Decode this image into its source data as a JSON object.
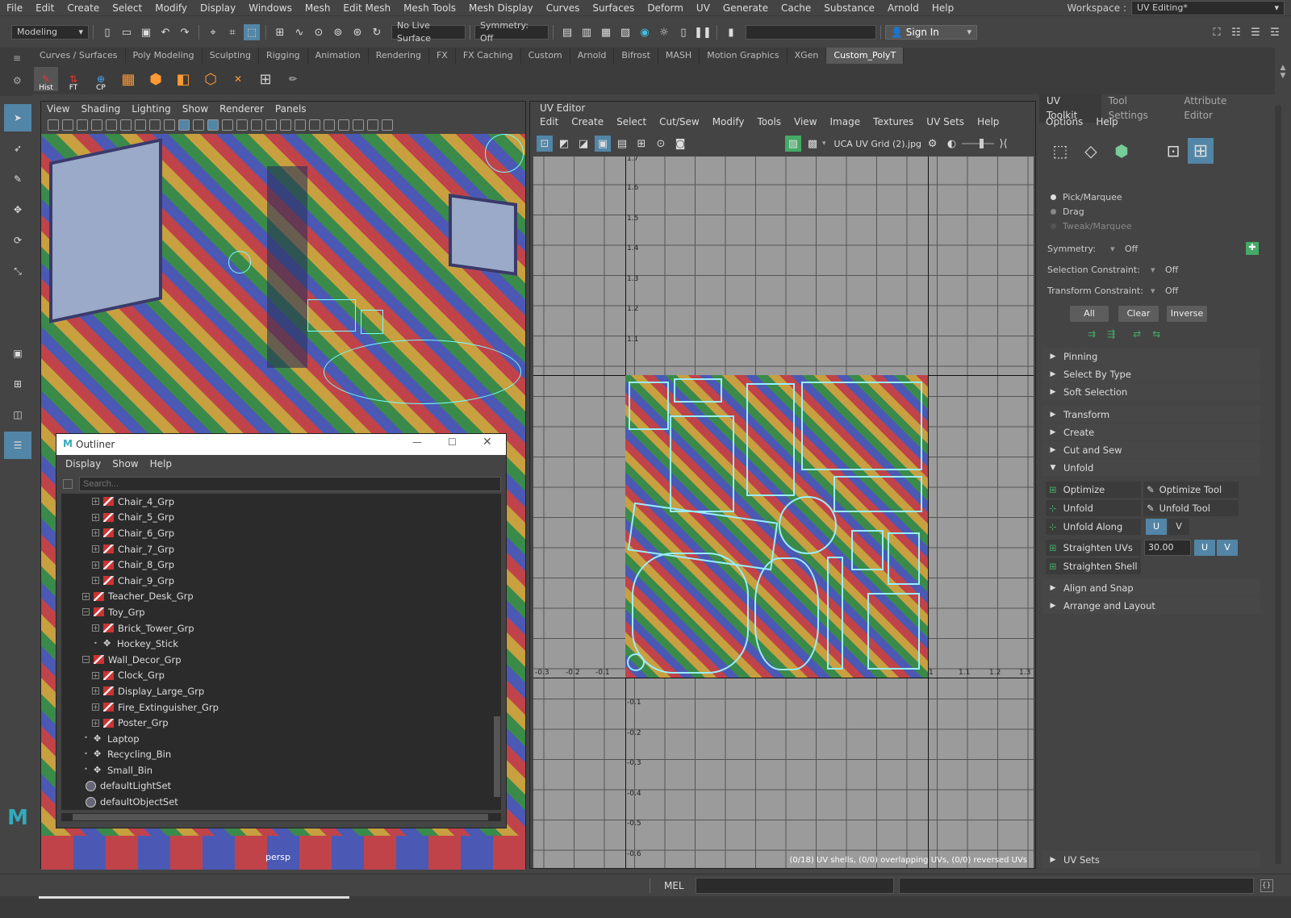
{
  "menubar": {
    "items": [
      "File",
      "Edit",
      "Create",
      "Select",
      "Modify",
      "Display",
      "Windows",
      "Mesh",
      "Edit Mesh",
      "Mesh Tools",
      "Mesh Display",
      "Curves",
      "Surfaces",
      "Deform",
      "UV",
      "Generate",
      "Cache",
      "Substance",
      "Arnold",
      "Help"
    ],
    "workspace_label": "Workspace :",
    "workspace_value": "UV Editing*"
  },
  "status": {
    "mode": "Modeling",
    "live_surface": "No Live Surface",
    "symmetry": "Symmetry: Off",
    "sign_in": "Sign In"
  },
  "shelf": {
    "tabs": [
      "Curves / Surfaces",
      "Poly Modeling",
      "Sculpting",
      "Rigging",
      "Animation",
      "Rendering",
      "FX",
      "FX Caching",
      "Custom",
      "Arnold",
      "Bifrost",
      "MASH",
      "Motion Graphics",
      "XGen",
      "Custom_PolyT"
    ],
    "active_tab": "Custom_PolyT",
    "captions": [
      "Hist",
      "FT",
      "CP"
    ]
  },
  "viewport": {
    "menu": [
      "View",
      "Shading",
      "Lighting",
      "Show",
      "Renderer",
      "Panels"
    ],
    "camera": "persp"
  },
  "outliner": {
    "title": "Outliner",
    "menu": [
      "Display",
      "Show",
      "Help"
    ],
    "search_placeholder": "Search...",
    "rows": [
      {
        "label": "Chair_4_Grp",
        "indent": 2,
        "kind": "group",
        "exp": "+"
      },
      {
        "label": "Chair_5_Grp",
        "indent": 2,
        "kind": "group",
        "exp": "+"
      },
      {
        "label": "Chair_6_Grp",
        "indent": 2,
        "kind": "group",
        "exp": "+"
      },
      {
        "label": "Chair_7_Grp",
        "indent": 2,
        "kind": "group",
        "exp": "+"
      },
      {
        "label": "Chair_8_Grp",
        "indent": 2,
        "kind": "group",
        "exp": "+"
      },
      {
        "label": "Chair_9_Grp",
        "indent": 2,
        "kind": "group",
        "exp": "+"
      },
      {
        "label": "Teacher_Desk_Grp",
        "indent": 1,
        "kind": "group",
        "exp": "+"
      },
      {
        "label": "Toy_Grp",
        "indent": 1,
        "kind": "group",
        "exp": "-"
      },
      {
        "label": "Brick_Tower_Grp",
        "indent": 2,
        "kind": "group",
        "exp": "+"
      },
      {
        "label": "Hockey_Stick",
        "indent": 2,
        "kind": "mesh",
        "exp": ""
      },
      {
        "label": "Wall_Decor_Grp",
        "indent": 1,
        "kind": "group",
        "exp": "-"
      },
      {
        "label": "Clock_Grp",
        "indent": 2,
        "kind": "group",
        "exp": "+"
      },
      {
        "label": "Display_Large_Grp",
        "indent": 2,
        "kind": "group",
        "exp": "+"
      },
      {
        "label": "Fire_Extinguisher_Grp",
        "indent": 2,
        "kind": "group",
        "exp": "+"
      },
      {
        "label": "Poster_Grp",
        "indent": 2,
        "kind": "group",
        "exp": "+"
      },
      {
        "label": "Laptop",
        "indent": 1,
        "kind": "mesh",
        "exp": ""
      },
      {
        "label": "Recycling_Bin",
        "indent": 1,
        "kind": "mesh",
        "exp": ""
      },
      {
        "label": "Small_Bin",
        "indent": 1,
        "kind": "mesh",
        "exp": ""
      },
      {
        "label": "defaultLightSet",
        "indent": 0,
        "kind": "set",
        "exp": ""
      },
      {
        "label": "defaultObjectSet",
        "indent": 0,
        "kind": "set",
        "exp": ""
      }
    ]
  },
  "uv_editor": {
    "title": "UV Editor",
    "menu": [
      "Edit",
      "Create",
      "Select",
      "Cut/Sew",
      "Modify",
      "Tools",
      "View",
      "Image",
      "Textures",
      "UV Sets",
      "Help"
    ],
    "texture": "UCA UV Grid (2).jpg",
    "v_ticks_pos": [
      "1.7",
      "1.6",
      "1.5",
      "1.4",
      "1.3",
      "1.2",
      "1.1"
    ],
    "v_ticks_neg": [
      "-0.1",
      "-0.2",
      "-0.3",
      "-0.4",
      "-0.5",
      "-0.6"
    ],
    "u_ticks_neg": [
      "-0.3",
      "-0.2",
      "-0.1"
    ],
    "u_ticks_pos": [
      "1",
      "1.1",
      "1.2",
      "1.3"
    ],
    "status": "(0/18) UV shells, (0/0) overlapping UVs, (0/0) reversed UVs"
  },
  "toolkit": {
    "tabs": [
      "UV Toolkit",
      "Tool Settings",
      "Attribute Editor"
    ],
    "menu": [
      "Options",
      "Help"
    ],
    "radios": [
      "Pick/Marquee",
      "Drag",
      "Tweak/Marquee"
    ],
    "symmetry_label": "Symmetry:",
    "symmetry_value": "Off",
    "sel_constraint_label": "Selection Constraint:",
    "sel_constraint_value": "Off",
    "xf_constraint_label": "Transform Constraint:",
    "xf_constraint_value": "Off",
    "buttons": [
      "All",
      "Clear",
      "Inverse"
    ],
    "sections_a": [
      "Pinning",
      "Select By Type",
      "Soft Selection"
    ],
    "sections_b": [
      "Transform",
      "Create",
      "Cut and Sew"
    ],
    "unfold": "Unfold",
    "optimize": "Optimize",
    "optimize_tool": "Optimize Tool",
    "unfold_btn": "Unfold",
    "unfold_tool": "Unfold Tool",
    "unfold_along": "Unfold Along",
    "u": "U",
    "v": "V",
    "straighten_uvs": "Straighten UVs",
    "straighten_value": "30.00",
    "straighten_shell": "Straighten Shell",
    "sections_c": [
      "Align and Snap",
      "Arrange and Layout"
    ],
    "uv_sets": "UV Sets"
  },
  "bottom": {
    "mel": "MEL"
  }
}
